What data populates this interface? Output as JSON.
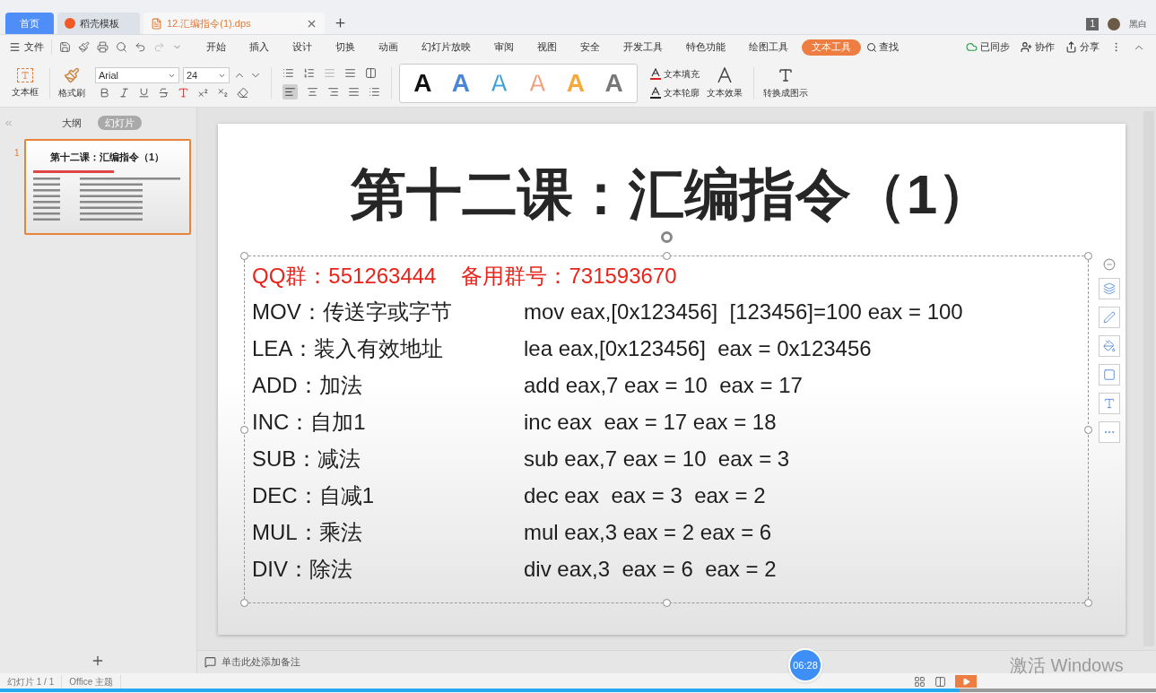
{
  "tabs": [
    {
      "label": "首页",
      "kind": "home",
      "selected": false
    },
    {
      "label": "稻壳模板",
      "kind": "docer",
      "selected": false
    },
    {
      "label": "12.汇编指令(1).dps",
      "kind": "file",
      "selected": true
    }
  ],
  "account": {
    "badge": "1",
    "name": "黑白"
  },
  "menu": {
    "file": "文件",
    "items": [
      {
        "label": "开始",
        "selected": false
      },
      {
        "label": "插入",
        "selected": false
      },
      {
        "label": "设计",
        "selected": false
      },
      {
        "label": "切换",
        "selected": false
      },
      {
        "label": "动画",
        "selected": false
      },
      {
        "label": "幻灯片放映",
        "selected": false
      },
      {
        "label": "审阅",
        "selected": false
      },
      {
        "label": "视图",
        "selected": false
      },
      {
        "label": "安全",
        "selected": false
      },
      {
        "label": "开发工具",
        "selected": false
      },
      {
        "label": "特色功能",
        "selected": false
      },
      {
        "label": "绘图工具",
        "selected": false
      },
      {
        "label": "文本工具",
        "selected": true
      }
    ],
    "search": "查找",
    "sync": "已同步",
    "collab": "协作",
    "share": "分享"
  },
  "toolbar": {
    "textbox": "文本框",
    "format_painter": "格式刷",
    "font": "Arial",
    "size": "24",
    "text_styles": [
      {
        "glyph": "A",
        "kind": "solid",
        "color": "#111111"
      },
      {
        "glyph": "A",
        "kind": "solid",
        "color": "#4a86d8"
      },
      {
        "glyph": "A",
        "kind": "outline",
        "color": "#3ea0d8"
      },
      {
        "glyph": "A",
        "kind": "outline",
        "color": "#f0a080"
      },
      {
        "glyph": "A",
        "kind": "solid",
        "color": "#f5a93a"
      },
      {
        "glyph": "A",
        "kind": "solid",
        "color": "#777777"
      }
    ],
    "fill": "文本填充",
    "outline": "文本轮廓",
    "effect": "文本效果",
    "convert": "转换成图示"
  },
  "sidebar": {
    "view_tabs": [
      {
        "label": "大纲",
        "selected": false
      },
      {
        "label": "幻灯片",
        "selected": true
      }
    ],
    "slides": [
      {
        "number": "1",
        "selected": true,
        "title": "第十二课：汇编指令（1）"
      }
    ]
  },
  "slide": {
    "title": "第十二课：汇编指令（1）",
    "contact": [
      "QQ群：551263444",
      "备用群号：731593670"
    ],
    "rows": [
      {
        "instruction": "MOV：传送字或字节",
        "example": "mov eax,[0x123456]  [123456]=100 eax = 100"
      },
      {
        "instruction": "LEA：装入有效地址",
        "example": "lea eax,[0x123456]  eax = 0x123456"
      },
      {
        "instruction": "ADD：加法",
        "example": "add eax,7 eax = 10  eax = 17"
      },
      {
        "instruction": "INC：自加1",
        "example": "inc eax  eax = 17 eax = 18"
      },
      {
        "instruction": "SUB：减法",
        "example": "sub eax,7 eax = 10  eax = 3"
      },
      {
        "instruction": "DEC：自减1",
        "example": "dec eax  eax = 3  eax = 2"
      },
      {
        "instruction": "MUL：乘法",
        "example": "mul eax,3 eax = 2 eax = 6"
      },
      {
        "instruction": "DIV：除法",
        "example": "div eax,3  eax = 6  eax = 2"
      }
    ]
  },
  "notes": {
    "placeholder": "单击此处添加备注"
  },
  "status_bar": [
    "幻灯片 1 / 1",
    "Office 主题"
  ],
  "video": {
    "time": "06:28",
    "level": 0.83
  },
  "os_notice": "激活 Windows"
}
